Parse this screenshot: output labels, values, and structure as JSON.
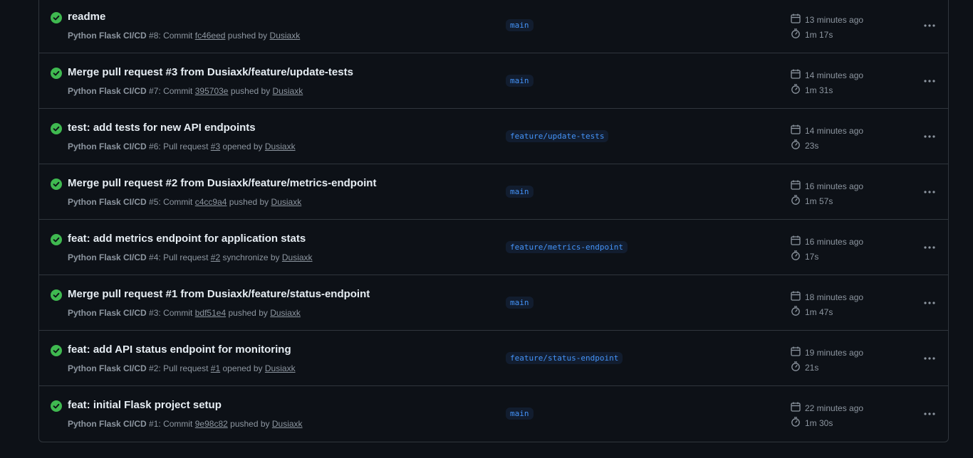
{
  "runs": [
    {
      "title": "readme",
      "workflow": "Python Flask CI/CD",
      "run_number": "#8",
      "event_text": "Commit",
      "ref": "fc46eed",
      "action": "pushed by",
      "actor": "Dusiaxk",
      "branch": "main",
      "started": "13 minutes ago",
      "duration": "1m 17s"
    },
    {
      "title": "Merge pull request #3 from Dusiaxk/feature/update-tests",
      "workflow": "Python Flask CI/CD",
      "run_number": "#7",
      "event_text": "Commit",
      "ref": "395703e",
      "action": "pushed by",
      "actor": "Dusiaxk",
      "branch": "main",
      "started": "14 minutes ago",
      "duration": "1m 31s"
    },
    {
      "title": "test: add tests for new API endpoints",
      "workflow": "Python Flask CI/CD",
      "run_number": "#6",
      "event_text": "Pull request",
      "ref": "#3",
      "action": "opened by",
      "actor": "Dusiaxk",
      "branch": "feature/update-tests",
      "started": "14 minutes ago",
      "duration": "23s"
    },
    {
      "title": "Merge pull request #2 from Dusiaxk/feature/metrics-endpoint",
      "workflow": "Python Flask CI/CD",
      "run_number": "#5",
      "event_text": "Commit",
      "ref": "c4cc9a4",
      "action": "pushed by",
      "actor": "Dusiaxk",
      "branch": "main",
      "started": "16 minutes ago",
      "duration": "1m 57s"
    },
    {
      "title": "feat: add metrics endpoint for application stats",
      "workflow": "Python Flask CI/CD",
      "run_number": "#4",
      "event_text": "Pull request",
      "ref": "#2",
      "action": "synchronize by",
      "actor": "Dusiaxk",
      "branch": "feature/metrics-endpoint",
      "started": "16 minutes ago",
      "duration": "17s"
    },
    {
      "title": "Merge pull request #1 from Dusiaxk/feature/status-endpoint",
      "workflow": "Python Flask CI/CD",
      "run_number": "#3",
      "event_text": "Commit",
      "ref": "bdf51e4",
      "action": "pushed by",
      "actor": "Dusiaxk",
      "branch": "main",
      "started": "18 minutes ago",
      "duration": "1m 47s"
    },
    {
      "title": "feat: add API status endpoint for monitoring",
      "workflow": "Python Flask CI/CD",
      "run_number": "#2",
      "event_text": "Pull request",
      "ref": "#1",
      "action": "opened by",
      "actor": "Dusiaxk",
      "branch": "feature/status-endpoint",
      "started": "19 minutes ago",
      "duration": "21s"
    },
    {
      "title": "feat: initial Flask project setup",
      "workflow": "Python Flask CI/CD",
      "run_number": "#1",
      "event_text": "Commit",
      "ref": "9e98c82",
      "action": "pushed by",
      "actor": "Dusiaxk",
      "branch": "main",
      "started": "22 minutes ago",
      "duration": "1m 30s"
    }
  ],
  "icons": {
    "status": "check-circle-fill-icon",
    "calendar": "calendar-icon",
    "duration": "stopwatch-icon",
    "menu": "kebab-horizontal-icon"
  },
  "colors": {
    "success": "#3fb950",
    "branch_text": "#4493f8",
    "branch_bg": "#121d2f",
    "muted_text": "#8d96a0",
    "border": "#30363d",
    "background": "#0d1117"
  }
}
